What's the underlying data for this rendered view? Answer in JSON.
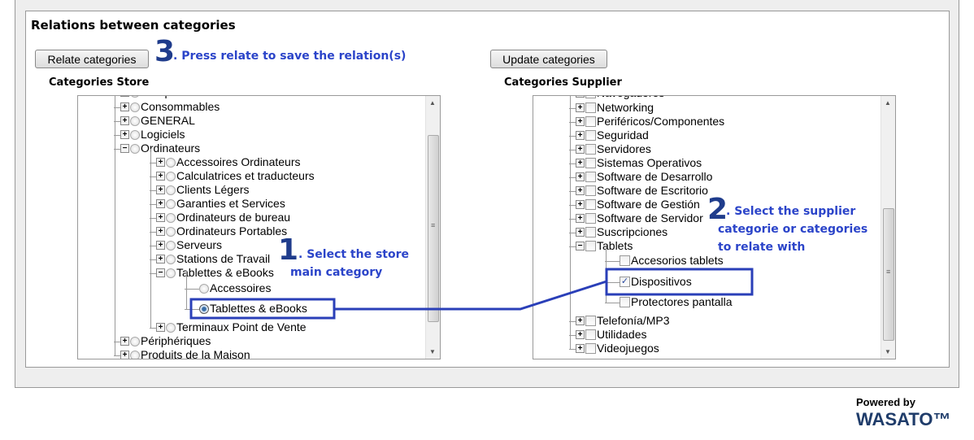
{
  "section_title": "Relations between categories",
  "buttons": {
    "relate": "Relate categories",
    "update": "Update categories"
  },
  "store": {
    "label": "Categories Store",
    "items": [
      {
        "text": "Composants",
        "level": 0,
        "exp": "+"
      },
      {
        "text": "Consommables",
        "level": 0,
        "exp": "+"
      },
      {
        "text": "GENERAL",
        "level": 0,
        "exp": "+"
      },
      {
        "text": "Logiciels",
        "level": 0,
        "exp": "+"
      },
      {
        "text": "Ordinateurs",
        "level": 0,
        "exp": "-"
      },
      {
        "text": "Accessoires Ordinateurs",
        "level": 1,
        "exp": "+"
      },
      {
        "text": "Calculatrices et traducteurs",
        "level": 1,
        "exp": "+"
      },
      {
        "text": "Clients Légers",
        "level": 1,
        "exp": "+"
      },
      {
        "text": "Garanties et Services",
        "level": 1,
        "exp": "+"
      },
      {
        "text": "Ordinateurs de bureau",
        "level": 1,
        "exp": "+"
      },
      {
        "text": "Ordinateurs Portables",
        "level": 1,
        "exp": "+"
      },
      {
        "text": "Serveurs",
        "level": 1,
        "exp": "+"
      },
      {
        "text": "Stations de Travail",
        "level": 1,
        "exp": "+"
      },
      {
        "text": "Tablettes & eBooks",
        "level": 1,
        "exp": "-"
      },
      {
        "text": "Accessoires",
        "level": 2,
        "exp": ""
      },
      {
        "text": "Tablettes & eBooks",
        "level": 2,
        "exp": "",
        "selected": true
      },
      {
        "text": "Terminaux Point de Vente",
        "level": 1,
        "exp": "+"
      },
      {
        "text": "Périphériques",
        "level": 0,
        "exp": "+"
      },
      {
        "text": "Produits de la Maison",
        "level": 0,
        "exp": "+"
      }
    ]
  },
  "supplier": {
    "label": "Categories Supplier",
    "items": [
      {
        "text": "Navegadores",
        "level": 0,
        "exp": "+"
      },
      {
        "text": "Networking",
        "level": 0,
        "exp": "+"
      },
      {
        "text": "Periféricos/Componentes",
        "level": 0,
        "exp": "+"
      },
      {
        "text": "Seguridad",
        "level": 0,
        "exp": "+"
      },
      {
        "text": "Servidores",
        "level": 0,
        "exp": "+"
      },
      {
        "text": "Sistemas Operativos",
        "level": 0,
        "exp": "+"
      },
      {
        "text": "Software de Desarrollo",
        "level": 0,
        "exp": "+"
      },
      {
        "text": "Software de Escritorio",
        "level": 0,
        "exp": "+"
      },
      {
        "text": "Software de Gestión",
        "level": 0,
        "exp": "+"
      },
      {
        "text": "Software de Servidor",
        "level": 0,
        "exp": "+"
      },
      {
        "text": "Suscripciones",
        "level": 0,
        "exp": "+"
      },
      {
        "text": "Tablets",
        "level": 0,
        "exp": "-"
      },
      {
        "text": "Accesorios tablets",
        "level": 1,
        "exp": ""
      },
      {
        "text": "Dispositivos",
        "level": 1,
        "exp": "",
        "checked": true
      },
      {
        "text": "Protectores pantalla",
        "level": 1,
        "exp": ""
      },
      {
        "text": "Telefonía/MP3",
        "level": 0,
        "exp": "+"
      },
      {
        "text": "Utilidades",
        "level": 0,
        "exp": "+"
      },
      {
        "text": "Videojuegos",
        "level": 0,
        "exp": "+"
      }
    ]
  },
  "annotations": {
    "step1": {
      "num": "1",
      "line1": ". Select the store",
      "line2": "main category"
    },
    "step2": {
      "num": "2",
      "line1": ". Select the supplier",
      "line2": "categorie or categories",
      "line3": "to relate with"
    },
    "step3": {
      "num": "3",
      "line1": ". Press relate to save the relation(s)"
    }
  },
  "footer": {
    "powered": "Powered by",
    "brand": "WASATO™"
  },
  "colors": {
    "annotation": "#2b44c9",
    "highlight": "#2a3fb8"
  }
}
